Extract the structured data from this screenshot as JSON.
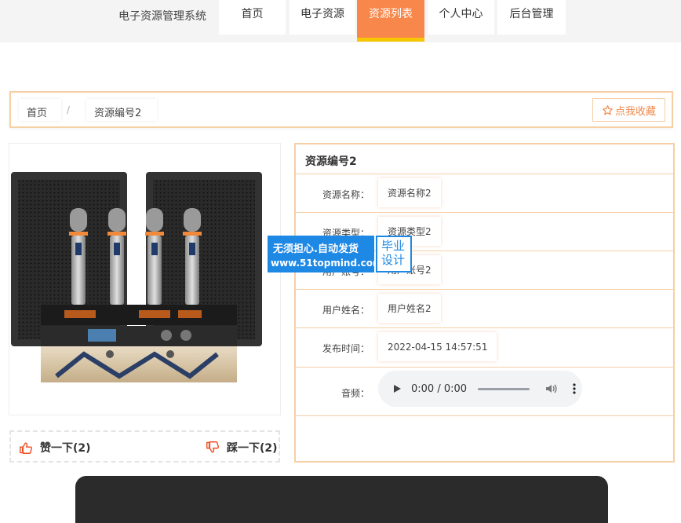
{
  "header": {
    "brand": "电子资源管理系统",
    "nav": [
      {
        "label": "首页"
      },
      {
        "label": "电子资源"
      },
      {
        "label": "资源列表"
      },
      {
        "label": "个人中心"
      },
      {
        "label": "后台管理"
      }
    ],
    "active_nav": "资源列表"
  },
  "breadcrumb": {
    "home": "首页",
    "separator": "/",
    "current": "资源编号2"
  },
  "favorite_label": "点我收藏",
  "votes": {
    "like_label": "赞一下(2)",
    "dislike_label": "踩一下(2)"
  },
  "detail": {
    "title": "资源编号2",
    "rows": [
      {
        "label": "资源名称：",
        "value": "资源名称2"
      },
      {
        "label": "资源类型：",
        "value": "资源类型2"
      },
      {
        "label": "用户账号：",
        "value": "用户账号2"
      },
      {
        "label": "用户姓名：",
        "value": "用户姓名2"
      },
      {
        "label": "发布时间：",
        "value": "2022-04-15 14:57:51"
      }
    ],
    "audio": {
      "label": "音频：",
      "time": "0:00 / 0:00"
    }
  },
  "watermark": {
    "line1": "无须担心.自动发货",
    "line2": "www.51topmind.com",
    "badge": "毕业设计"
  },
  "colors": {
    "accent": "#f7874a",
    "accent_underline": "#f6c700",
    "border": "#f6cfa4",
    "watermark": "#1e88e5",
    "footer": "#2b2b2b"
  }
}
